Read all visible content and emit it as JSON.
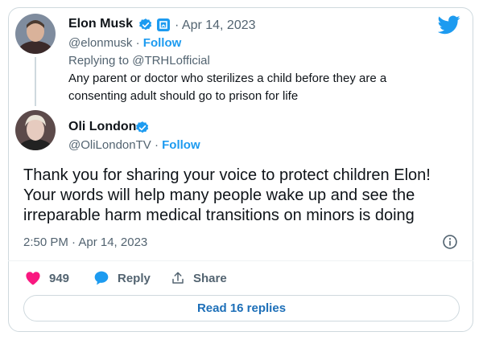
{
  "reply_tweet": {
    "name": "Elon Musk",
    "date": "Apr 14, 2023",
    "handle": "@elonmusk",
    "follow": "Follow",
    "replying_to": "Replying to @TRHLofficial",
    "text": "Any parent or doctor who sterilizes a child before they are a consenting adult should go to prison for life"
  },
  "main_tweet": {
    "name": "Oli London",
    "handle": "@OliLondonTV",
    "follow": "Follow",
    "text": "Thank you for sharing your voice to protect children Elon! Your words will help many people wake up and see the irreparable harm medical transitions on minors is doing",
    "timestamp": "2:50 PM · Apr 14, 2023"
  },
  "actions": {
    "likes": "949",
    "reply": "Reply",
    "share": "Share"
  },
  "read_replies": "Read 16 replies",
  "colors": {
    "accent": "#1d9bf0",
    "like": "#f91880",
    "text": "#0f1419",
    "muted": "#536471"
  }
}
